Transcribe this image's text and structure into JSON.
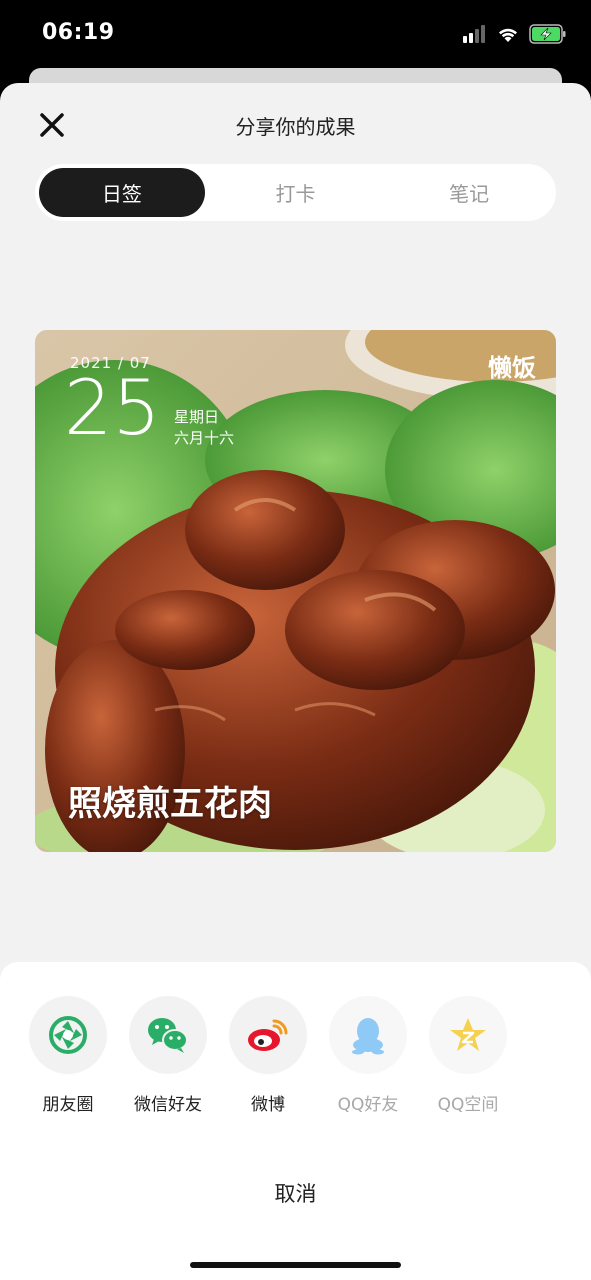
{
  "status_bar": {
    "time": "06:19"
  },
  "header": {
    "title": "分享你的成果"
  },
  "tabs": [
    {
      "label": "日签",
      "active": true
    },
    {
      "label": "打卡",
      "active": false
    },
    {
      "label": "笔记",
      "active": false
    }
  ],
  "card": {
    "year_month": "2021 / 07",
    "day": "25",
    "weekday": "星期日",
    "lunar_date": "六月十六",
    "brand": "懒饭",
    "dish_name": "照烧煎五花肉"
  },
  "share_targets": [
    {
      "label": "朋友圈",
      "icon": "moments-icon",
      "enabled": true
    },
    {
      "label": "微信好友",
      "icon": "wechat-icon",
      "enabled": true
    },
    {
      "label": "微博",
      "icon": "weibo-icon",
      "enabled": true
    },
    {
      "label": "QQ好友",
      "icon": "qq-icon",
      "enabled": false
    },
    {
      "label": "QQ空间",
      "icon": "qzone-icon",
      "enabled": false
    }
  ],
  "cancel_label": "取消",
  "colors": {
    "wechat_green": "#2aae67",
    "weibo_red": "#e6162d",
    "qq_blue": "#8fc9f5",
    "qzone_yellow": "#f5d14f",
    "tab_active_bg": "#1c1c1c"
  }
}
